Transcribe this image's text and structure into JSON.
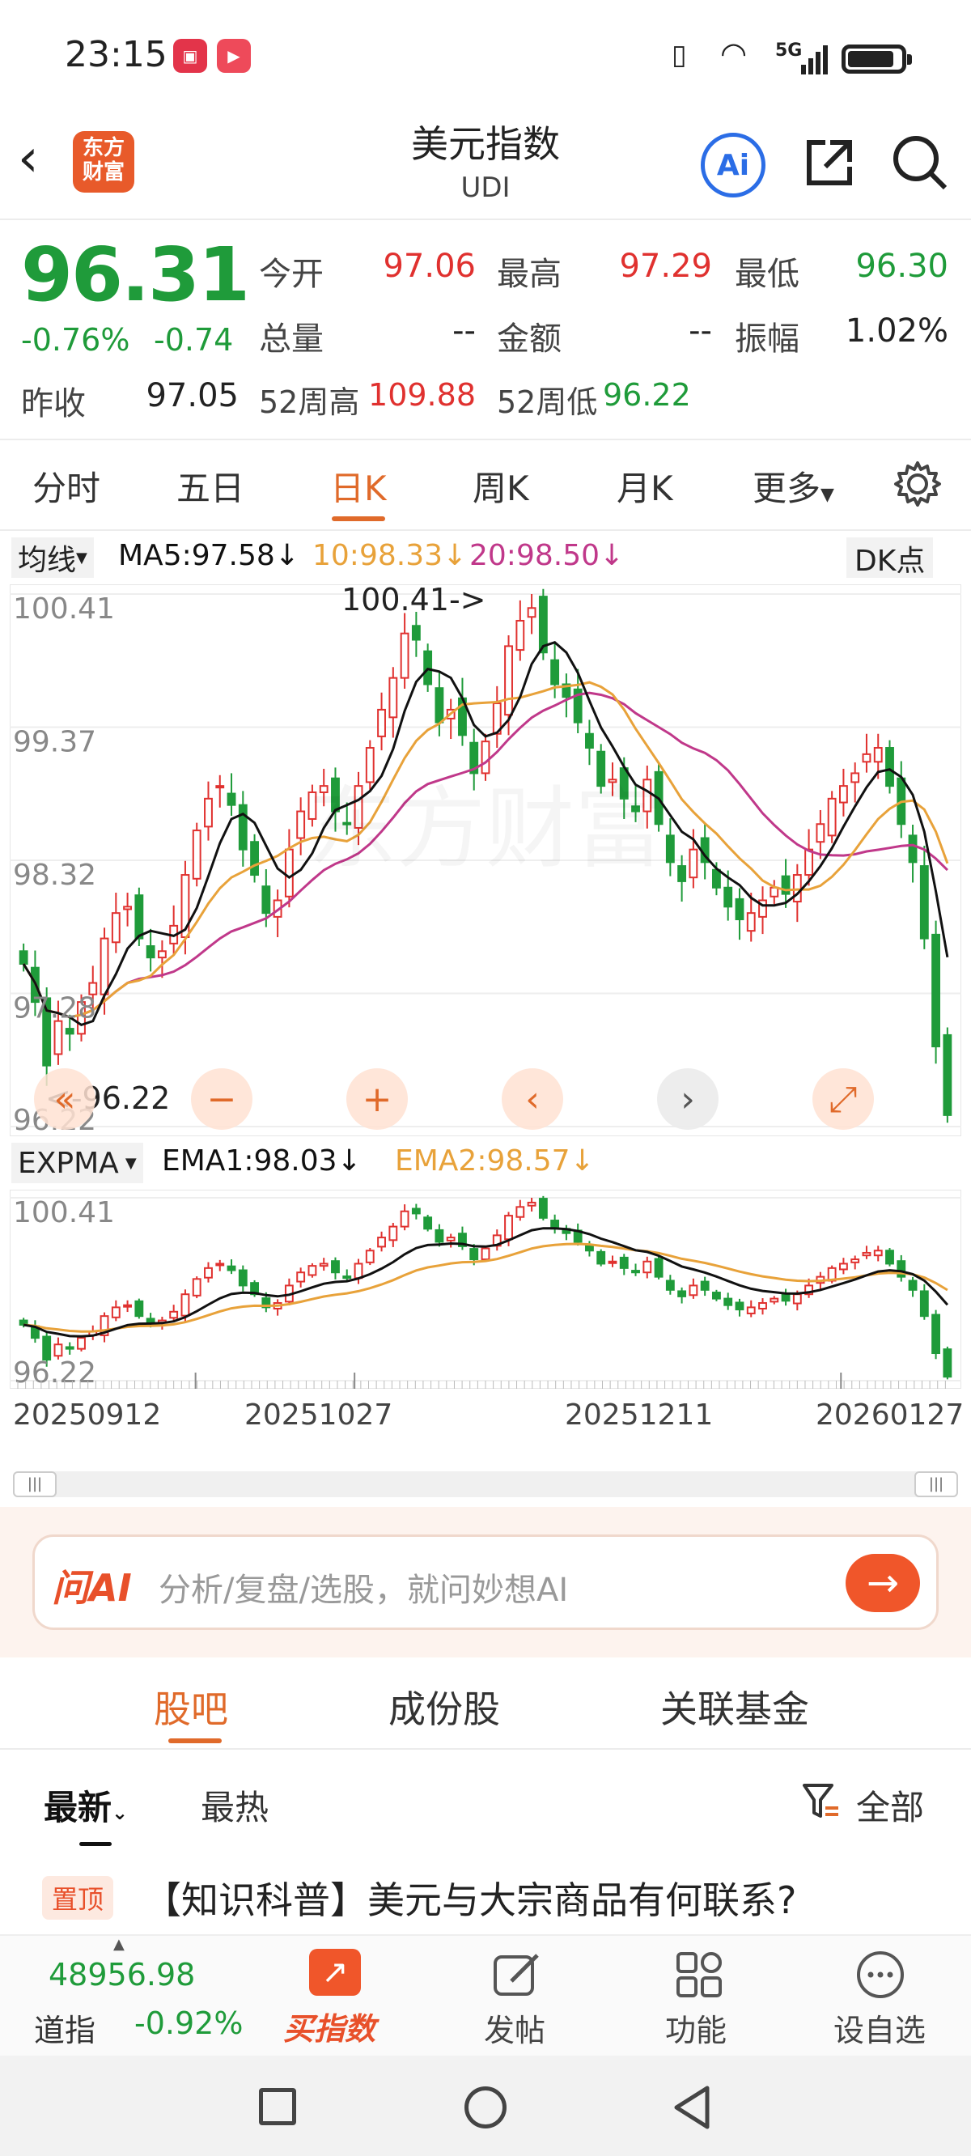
{
  "status": {
    "time": "23:15",
    "net": "5G"
  },
  "header": {
    "title": "美元指数",
    "subtitle": "UDI",
    "logo_text": "东方财富",
    "ai_label": "Ai"
  },
  "quote": {
    "price": "96.31",
    "change_pct": "-0.76%",
    "change": "-0.74",
    "prev_close_label": "昨收",
    "prev_close": "97.05",
    "open_label": "今开",
    "open": "97.06",
    "high_label": "最高",
    "high": "97.29",
    "low_label": "最低",
    "low": "96.30",
    "volume_label": "总量",
    "volume": "--",
    "amount_label": "金额",
    "amount": "--",
    "amplitude_label": "振幅",
    "amplitude": "1.02%",
    "wk52_high_label": "52周高",
    "wk52_high": "109.88",
    "wk52_low_label": "52周低",
    "wk52_low": "96.22"
  },
  "tabs": [
    "分时",
    "五日",
    "日K",
    "周K",
    "月K",
    "更多"
  ],
  "active_tab": "日K",
  "ma_bar": {
    "selector": "均线",
    "ma5": "MA5:97.58",
    "ma10": "10:98.33",
    "ma20": "20:98.50",
    "dk": "DK点"
  },
  "main_chart": {
    "y_labels": [
      "100.41",
      "99.37",
      "98.32",
      "97.28",
      "96.22"
    ],
    "max_note": "100.41->",
    "min_note": "<-96.22",
    "watermark": "东方财富"
  },
  "ema_bar": {
    "selector": "EXPMA",
    "ema1": "EMA1:98.03",
    "ema2": "EMA2:98.57"
  },
  "sub_chart": {
    "y_labels": [
      "100.41",
      "96.22"
    ]
  },
  "x_dates": [
    "20250912",
    "20251027",
    "20251211",
    "20260127"
  ],
  "chart_data": {
    "type": "candlestick",
    "ylim": [
      96.22,
      100.41
    ],
    "x_ticks": [
      "20250912",
      "20251027",
      "20251211",
      "20260127"
    ],
    "closes": [
      97.5,
      97.2,
      96.7,
      97.05,
      96.95,
      97.2,
      97.35,
      97.7,
      97.9,
      97.95,
      97.7,
      97.55,
      97.6,
      97.8,
      98.2,
      98.55,
      98.8,
      98.9,
      98.75,
      98.4,
      98.2,
      97.9,
      98.0,
      98.4,
      98.7,
      98.85,
      98.9,
      98.7,
      98.6,
      98.9,
      99.2,
      99.5,
      99.75,
      100.1,
      100.05,
      99.7,
      99.4,
      99.5,
      99.3,
      99.0,
      99.25,
      99.55,
      100.0,
      100.2,
      100.3,
      99.95,
      99.7,
      99.6,
      99.4,
      99.2,
      98.9,
      98.95,
      98.8,
      98.7,
      98.95,
      98.6,
      98.3,
      98.15,
      98.4,
      98.3,
      98.1,
      97.95,
      97.85,
      97.9,
      98.0,
      98.1,
      98.05,
      98.2,
      98.4,
      98.6,
      98.8,
      98.9,
      99.0,
      99.15,
      99.2,
      98.9,
      98.6,
      98.3,
      97.7,
      96.85,
      96.31
    ]
  },
  "ai_box": {
    "brand": "问AI",
    "placeholder": "分析/复盘/选股，就问妙想AI"
  },
  "bottom_tabs": [
    "股吧",
    "成份股",
    "关联基金"
  ],
  "sort": {
    "latest": "最新",
    "hot": "最热",
    "filter": "全部"
  },
  "pinned": {
    "badge": "置顶",
    "title": "【知识科普】美元与大宗商品有何联系?"
  },
  "nav": {
    "index_value": "48956.98",
    "index_name": "道指",
    "index_change": "-0.92%",
    "buy_label": "买指数",
    "post_label": "发帖",
    "func_label": "功能",
    "watch_label": "设自选"
  },
  "colors": {
    "up": "#e0312f",
    "down": "#1f9b3a",
    "accent": "#e06a2a",
    "ma5": "#111111",
    "ma10": "#e8a23a",
    "ma20": "#c0388a"
  }
}
